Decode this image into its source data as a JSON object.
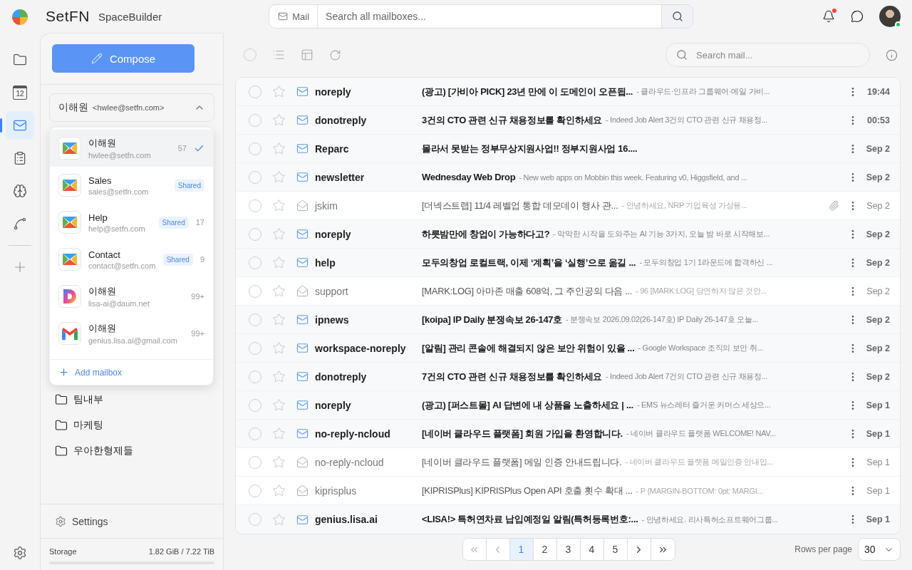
{
  "brand": {
    "name": "SetFN",
    "product": "SpaceBuilder"
  },
  "top_search": {
    "scope": "Mail",
    "placeholder": "Search all mailboxes..."
  },
  "notifications": {
    "unread": true
  },
  "rail": [
    {
      "kind": "folder",
      "selected": false
    },
    {
      "kind": "calendar",
      "day": "12",
      "selected": false
    },
    {
      "kind": "mail",
      "selected": true
    },
    {
      "kind": "clipboard",
      "selected": false
    },
    {
      "kind": "brain",
      "selected": false
    },
    {
      "kind": "route",
      "selected": false
    }
  ],
  "sidebar": {
    "compose": "Compose",
    "current_mailbox": {
      "name": "이해원",
      "address": "<hwlee@setfn.com>",
      "expanded": true
    },
    "mailbox_menu": [
      {
        "kind": "setfn",
        "name": "이해원",
        "address": "hwlee@setfn.com",
        "count": "57",
        "shared": false,
        "selected": true
      },
      {
        "kind": "setfn",
        "name": "Sales",
        "address": "sales@setfn.com",
        "tag": "Shared",
        "shared": true,
        "selected": false
      },
      {
        "kind": "setfn",
        "name": "Help",
        "address": "help@setfn.com",
        "tag": "Shared",
        "count": "17",
        "shared": true,
        "selected": false
      },
      {
        "kind": "setfn",
        "name": "Contact",
        "address": "contact@setfn.com",
        "tag": "Shared",
        "count": "9",
        "shared": true,
        "selected": false
      },
      {
        "kind": "daum",
        "name": "이해원",
        "address": "lisa-ai@daum.net",
        "count": "99+",
        "shared": false,
        "selected": false
      },
      {
        "kind": "gmail",
        "name": "이해원",
        "address": "genius.lisa.ai@gmail.com",
        "count": "99+",
        "shared": false,
        "selected": false
      }
    ],
    "add_mailbox": "Add mailbox",
    "folders": [
      "팀내부",
      "마케팅",
      "우아한형제들"
    ],
    "settings": "Settings",
    "storage": {
      "label": "Storage",
      "reading": "1.82 GiB / 7.22 TiB",
      "level": 0.0003
    }
  },
  "toolbar": {
    "select_all": false,
    "search_placeholder": "Search mail..."
  },
  "emails": [
    {
      "sender": "noreply",
      "subject": "(광고) [가비아 PICK] 23년 만에 이 도메인이 오픈됩...",
      "preview": "- 클라우드·인프라 그룹웨어·메일 가비...",
      "date": "19:44",
      "unread": true,
      "attachment": false,
      "starred": false,
      "selected": false
    },
    {
      "sender": "donotreply",
      "subject": "3건의 CTO 관련 신규 채용정보를 확인하세요",
      "preview": "- Indeed Job Alert 3건의 CTO 관련 신규 채용정...",
      "date": "00:53",
      "unread": true,
      "attachment": false,
      "starred": false,
      "selected": false
    },
    {
      "sender": "Reparc",
      "subject": "몰라서 못받는 정부무상지원사업!! 정부지원사업 16....",
      "date": "Sep 2",
      "unread": true,
      "attachment": false,
      "starred": false,
      "selected": false
    },
    {
      "sender": "newsletter",
      "subject": "Wednesday Web Drop",
      "preview": "- New web apps on Mobbin this week. Featuring v0, Higgsfield, and ...",
      "date": "Sep 2",
      "unread": true,
      "attachment": false,
      "starred": false,
      "selected": false
    },
    {
      "sender": "jskim",
      "subject": "[더넥스트랩] 11/4 레벨업 통합 데모데이 행사 관...",
      "preview": "- 안녕하세요, NRP 기업육성 가상융...",
      "date": "Sep 2",
      "unread": false,
      "attachment": true,
      "starred": false,
      "selected": false
    },
    {
      "sender": "noreply",
      "subject": "하룻밤만에 창업이 가능하다고?",
      "preview": "- 막막한 시작을 도와주는 AI 기능 3가지, 오늘 밤 바로 시작해보...",
      "date": "Sep 2",
      "unread": true,
      "attachment": false,
      "starred": false,
      "selected": false
    },
    {
      "sender": "help",
      "subject": "모두의창업 로컬트랙, 이제 ‘계획’을 ‘실행’으로 옮길 ...",
      "preview": "- 모두의창업 1기 1라운드에 합격하신 ...",
      "date": "Sep 2",
      "unread": true,
      "attachment": false,
      "starred": false,
      "selected": false
    },
    {
      "sender": "support",
      "subject": "[MARK:LOG] 아마존 매출 608억, 그 주인공의 다음 ...",
      "preview": "- 96 [MARK:LOG] 당연하지 않은 것안...",
      "date": "Sep 2",
      "unread": false,
      "attachment": false,
      "starred": false,
      "selected": false
    },
    {
      "sender": "ipnews",
      "subject": "[koipa] IP Daily 분쟁속보 26-147호",
      "preview": "- 분쟁속보 2026.09.02(26-147호) IP Daily 26-147호 오늘...",
      "date": "Sep 2",
      "unread": true,
      "attachment": false,
      "starred": false,
      "selected": false
    },
    {
      "sender": "workspace-noreply",
      "subject": "[알림] 관리 콘솔에 해결되지 않은 보안 위험이 있을 ...",
      "preview": "- Google Workspace 조직의 보안 취...",
      "date": "Sep 2",
      "unread": true,
      "attachment": false,
      "starred": false,
      "selected": false
    },
    {
      "sender": "donotreply",
      "subject": "7건의 CTO 관련 신규 채용정보를 확인하세요",
      "preview": "- Indeed Job Alert 7건의 CTO 관련 신규 채용정...",
      "date": "Sep 2",
      "unread": true,
      "attachment": false,
      "starred": false,
      "selected": false
    },
    {
      "sender": "noreply",
      "subject": "(광고) [퍼스트몰] AI 답변에 내 상품을 노출하세요 | ...",
      "preview": "- EMS 뉴스레터 즐거운 커머스 세상으...",
      "date": "Sep 1",
      "unread": true,
      "attachment": false,
      "starred": false,
      "selected": false
    },
    {
      "sender": "no-reply-ncloud",
      "subject": "[네이버 클라우드 플랫폼] 회원 가입을 환영합니다.",
      "preview": "- 네이버 클라우드 플랫폼 WELCOME! NAV...",
      "date": "Sep 1",
      "unread": true,
      "attachment": false,
      "starred": false,
      "selected": false
    },
    {
      "sender": "no-reply-ncloud",
      "subject": "[네이버 클라우드 플랫폼] 메일 인증 안내드립니다.",
      "preview": "- 네이버 클라우드 플랫폼 메일인증 안내입...",
      "date": "Sep 1",
      "unread": false,
      "attachment": false,
      "starred": false,
      "selected": false
    },
    {
      "sender": "kiprisplus",
      "subject": "[KIPRISPlus] KIPRISPlus Open API 호출 횟수 확대 ...",
      "preview": "- P {MARGIN-BOTTOM: 0pt; MARGI...",
      "date": "Sep 1",
      "unread": false,
      "attachment": false,
      "starred": false,
      "selected": false
    },
    {
      "sender": "genius.lisa.ai",
      "subject": "<LISA!> 특허연차료 납입예정일 알림(특허등록번호:...",
      "preview": "- 안녕하세요. 리사특허소프트웨어그룹...",
      "date": "Sep 1",
      "unread": true,
      "attachment": false,
      "starred": false,
      "selected": false
    }
  ],
  "pagination": {
    "pages": [
      {
        "label": "1",
        "selected": true
      },
      {
        "label": "2",
        "selected": false
      },
      {
        "label": "3",
        "selected": false
      },
      {
        "label": "4",
        "selected": false
      },
      {
        "label": "5",
        "selected": false
      }
    ],
    "rows_label": "Rows per page",
    "rows_value": "30"
  }
}
